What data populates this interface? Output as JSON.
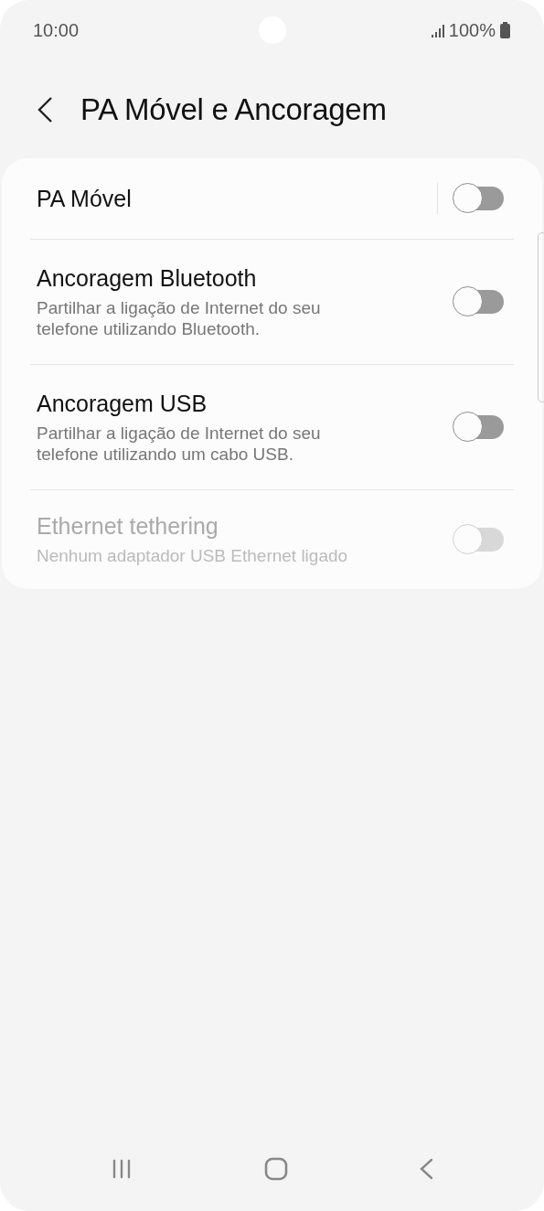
{
  "status_bar": {
    "time": "10:00",
    "battery": "100%"
  },
  "header": {
    "title": "PA Móvel e Ancoragem"
  },
  "settings": [
    {
      "kind": "split-switch",
      "title": "PA Móvel",
      "on": false,
      "disabled": false
    },
    {
      "kind": "switch",
      "title": "Ancoragem Bluetooth",
      "subtitle": "Partilhar a ligação de Internet do seu telefone utilizando Bluetooth.",
      "on": false,
      "disabled": false
    },
    {
      "kind": "switch",
      "title": "Ancoragem USB",
      "subtitle": "Partilhar a ligação de Internet do seu telefone utilizando um cabo USB.",
      "on": false,
      "disabled": false
    },
    {
      "kind": "switch",
      "title": "Ethernet tethering",
      "subtitle": "Nenhum adaptador USB Ethernet ligado",
      "on": false,
      "disabled": true
    }
  ]
}
